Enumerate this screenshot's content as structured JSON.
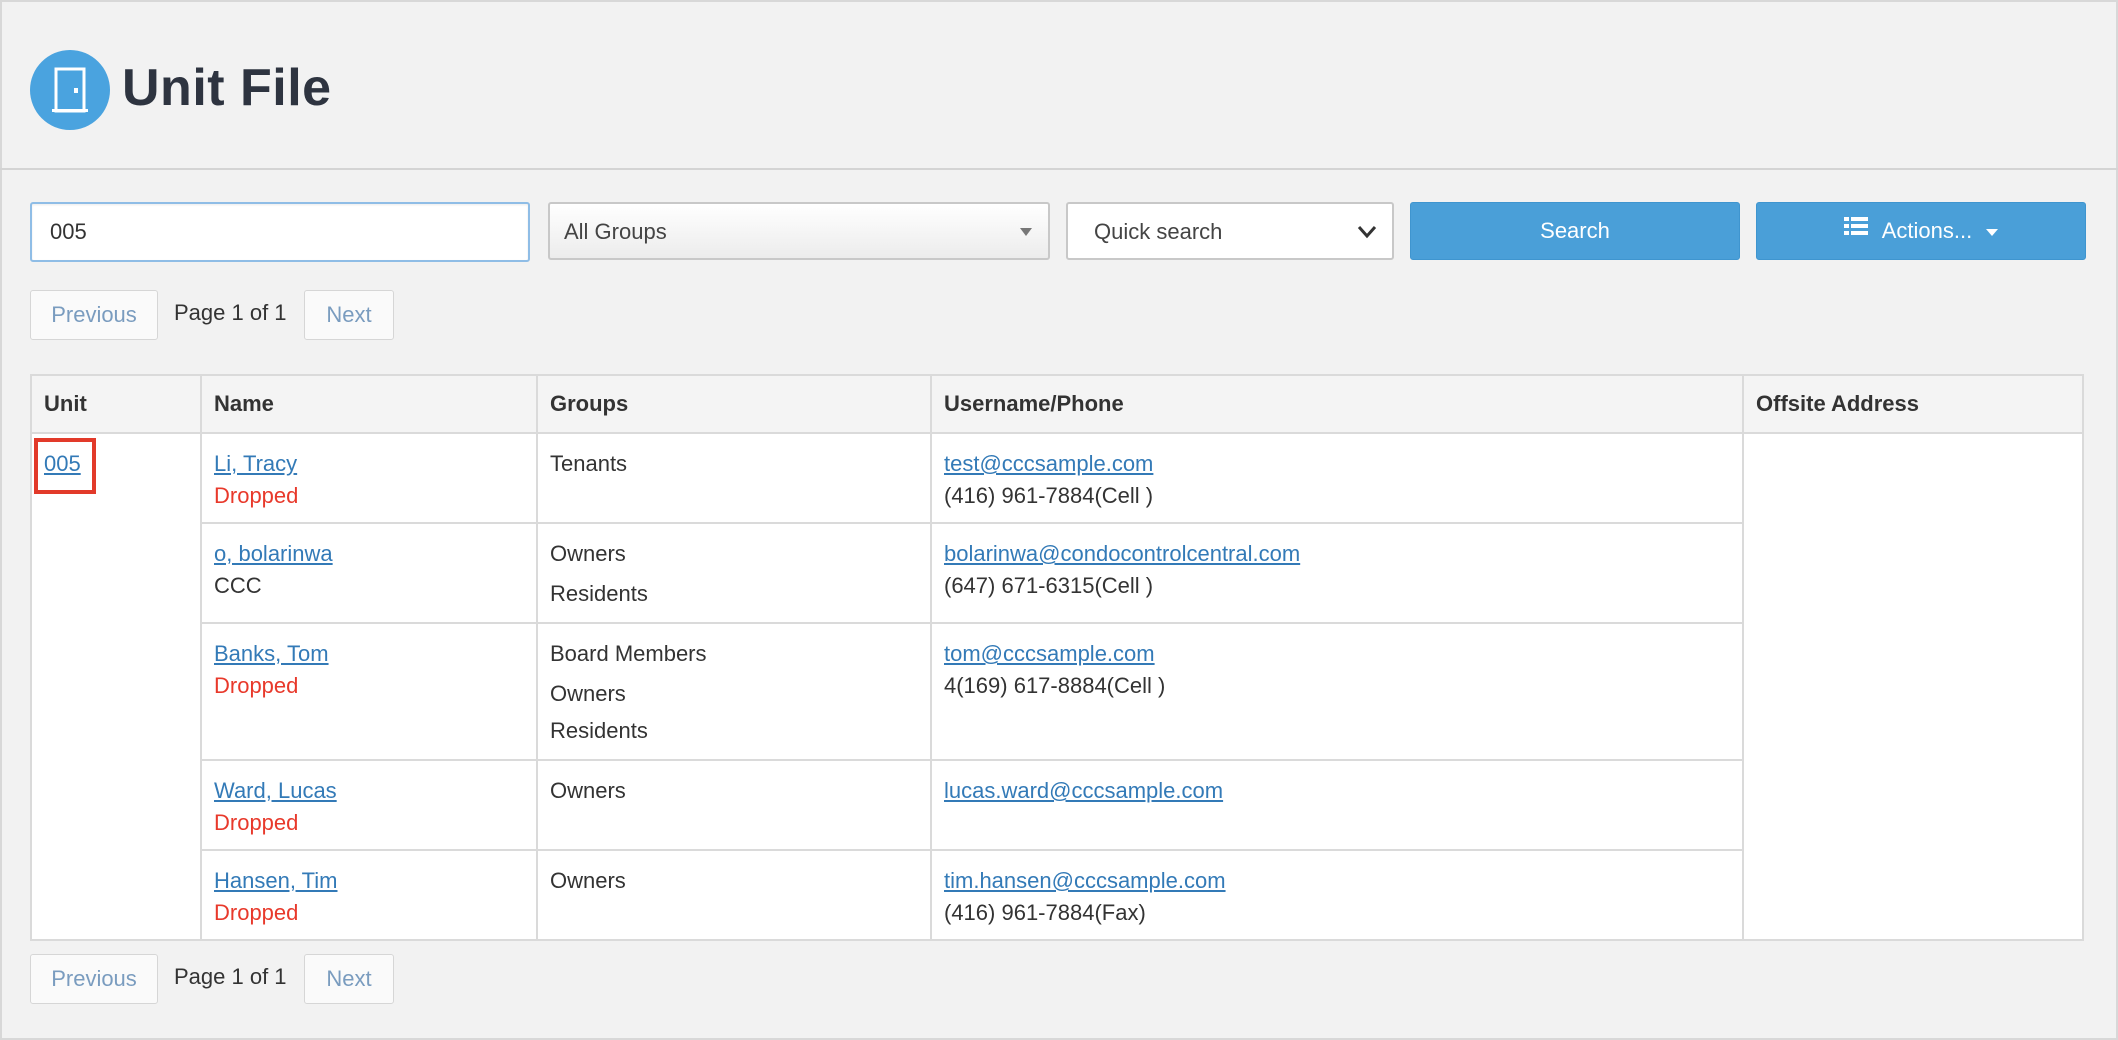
{
  "header": {
    "title": "Unit File",
    "icon": "door-icon"
  },
  "filters": {
    "search_value": "005",
    "groups_value": "All Groups",
    "quick_search_value": "Quick search",
    "search_button": "Search",
    "actions_button": "Actions..."
  },
  "pager": {
    "previous": "Previous",
    "page_info": "Page 1 of 1",
    "next": "Next"
  },
  "table": {
    "columns": [
      "Unit",
      "Name",
      "Groups",
      "Username/Phone",
      "Offsite Address"
    ],
    "unit": "005",
    "offsite_address": "",
    "rows": [
      {
        "name": "Li, Tracy",
        "status": "Dropped",
        "groups": [
          "Tenants"
        ],
        "email": "test@cccsample.com",
        "phone": "(416) 961-7884(Cell )"
      },
      {
        "name": "o, bolarinwa",
        "status": "CCC",
        "groups": [
          "Owners",
          "Residents"
        ],
        "email": "bolarinwa@condocontrolcentral.com",
        "phone": "(647) 671-6315(Cell )"
      },
      {
        "name": "Banks, Tom",
        "status": "Dropped",
        "groups": [
          "Board Members",
          "Owners",
          "Residents"
        ],
        "email": "tom@cccsample.com",
        "phone": "4(169) 617-8884(Cell )"
      },
      {
        "name": "Ward, Lucas",
        "status": "Dropped",
        "groups": [
          "Owners"
        ],
        "email": "lucas.ward@cccsample.com",
        "phone": ""
      },
      {
        "name": "Hansen, Tim",
        "status": "Dropped",
        "groups": [
          "Owners"
        ],
        "email": "tim.hansen@cccsample.com",
        "phone": "(416) 961-7884(Fax)"
      }
    ]
  },
  "colors": {
    "accent": "#4a9fd8",
    "link": "#337ab7",
    "dropped": "#e8392b",
    "highlight": "#e23a2a"
  }
}
